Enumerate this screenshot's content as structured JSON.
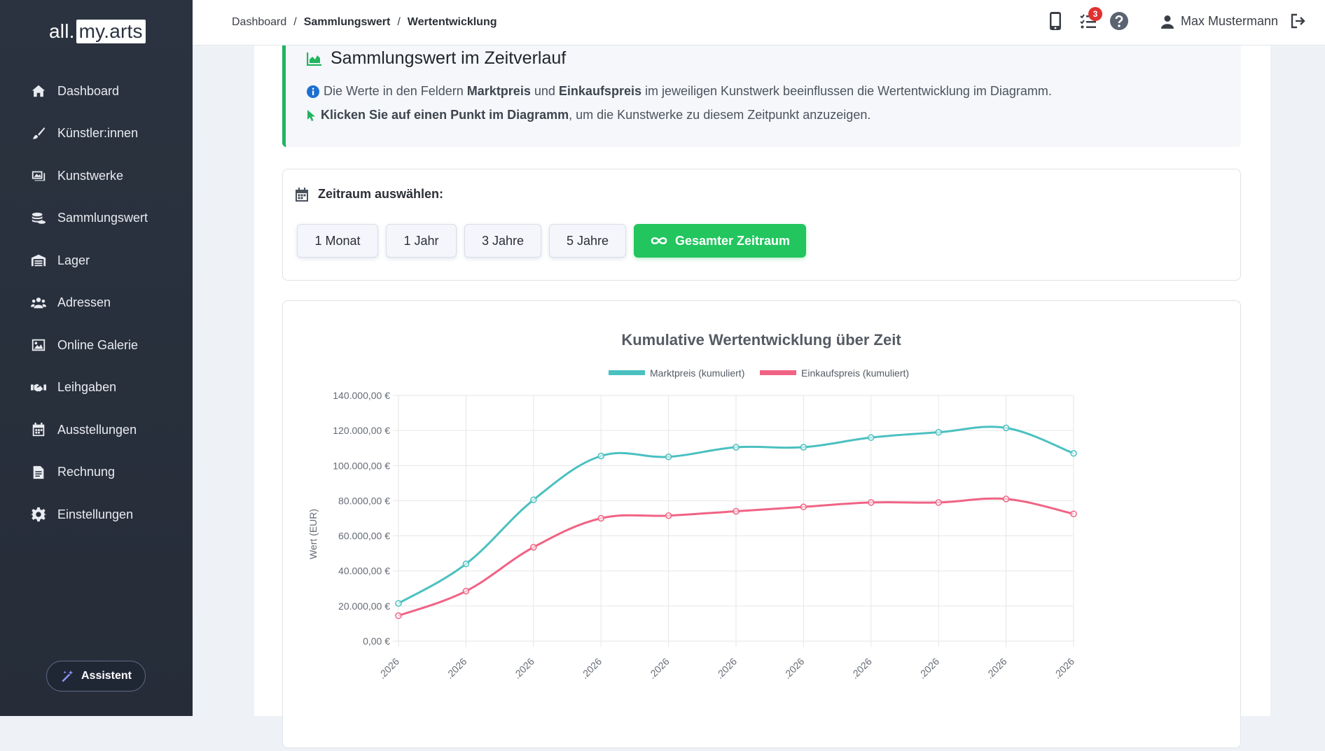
{
  "logo": {
    "part1": "all.",
    "part2": "my.arts"
  },
  "sidebar": {
    "items": [
      {
        "label": "Dashboard",
        "icon": "home-icon"
      },
      {
        "label": "Künstler:innen",
        "icon": "paintbrush-icon"
      },
      {
        "label": "Kunstwerke",
        "icon": "images-icon"
      },
      {
        "label": "Sammlungswert",
        "icon": "coins-icon"
      },
      {
        "label": "Lager",
        "icon": "warehouse-icon"
      },
      {
        "label": "Adressen",
        "icon": "users-icon"
      },
      {
        "label": "Online Galerie",
        "icon": "image-icon"
      },
      {
        "label": "Leihgaben",
        "icon": "handshake-icon"
      },
      {
        "label": "Ausstellungen",
        "icon": "calendar-icon"
      },
      {
        "label": "Rechnung",
        "icon": "invoice-icon"
      },
      {
        "label": "Einstellungen",
        "icon": "gear-icon"
      }
    ],
    "assistant_label": "Assistent"
  },
  "header": {
    "breadcrumb": [
      "Dashboard",
      "Sammlungswert",
      "Wertentwicklung"
    ],
    "tasks_badge": "3",
    "user_name": "Max Mustermann"
  },
  "alert": {
    "title": "Sammlungswert im Zeitverlauf",
    "line1": {
      "pre": "Die Werte in den Feldern ",
      "b1": "Marktpreis",
      "mid": " und ",
      "b2": "Einkaufspreis",
      "post": " im jeweiligen Kunstwerk beeinflussen die Wertentwicklung im Diagramm."
    },
    "line2": {
      "b": "Klicken Sie auf einen Punkt im Diagramm",
      "post": ", um die Kunstwerke zu diesem Zeitpunkt anzuzeigen."
    }
  },
  "range": {
    "title": "Zeitraum auswählen:",
    "buttons": [
      "1 Monat",
      "1 Jahr",
      "3 Jahre",
      "5 Jahre",
      "Gesamter Zeitraum"
    ],
    "active_index": 4
  },
  "colors": {
    "accent_green": "#22c55e",
    "market_line": "#4bc0c0",
    "purchase_line": "#f06384"
  },
  "chart_data": {
    "type": "line",
    "title": "Kumulative Wertentwicklung über Zeit",
    "ylabel": "Wert (EUR)",
    "ylim": [
      0,
      140000
    ],
    "yticks": [
      "0,00 €",
      "20.000,00 €",
      "40.000,00 €",
      "60.000,00 €",
      "80.000,00 €",
      "100.000,00 €",
      "120.000,00 €",
      "140.000,00 €"
    ],
    "x": [
      ".2026",
      ".2026",
      ".2026",
      ".2026",
      ".2026",
      ".2026",
      ".2026",
      ".2026",
      ".2026",
      ".2026",
      ".2026"
    ],
    "legend_position": "top",
    "grid": true,
    "series": [
      {
        "name": "Marktpreis (kumuliert)",
        "values": [
          21500,
          44000,
          80500,
          105500,
          105000,
          110500,
          110500,
          116000,
          119000,
          121500,
          107000
        ]
      },
      {
        "name": "Einkaufspreis (kumuliert)",
        "values": [
          14500,
          28500,
          53500,
          70000,
          71500,
          74000,
          76500,
          79000,
          79000,
          81000,
          72500
        ]
      }
    ]
  }
}
